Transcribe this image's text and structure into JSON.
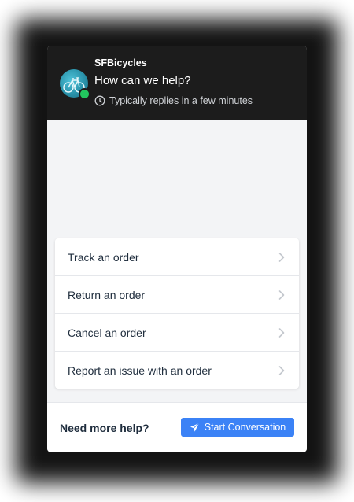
{
  "header": {
    "brand": "SFBicycles",
    "title": "How can we help?",
    "reply_time": "Typically replies in a few minutes",
    "avatar_icon": "bicycle-icon",
    "status": "online"
  },
  "menu": {
    "items": [
      {
        "label": "Track an order",
        "icon": "chevron-right-icon"
      },
      {
        "label": "Return an order",
        "icon": "chevron-right-icon"
      },
      {
        "label": "Cancel an order",
        "icon": "chevron-right-icon"
      },
      {
        "label": "Report an issue with an order",
        "icon": "chevron-right-icon"
      }
    ]
  },
  "footer": {
    "prompt": "Need more help?",
    "button_label": "Start Conversation",
    "button_icon": "paper-plane-icon"
  },
  "colors": {
    "header_bg": "#1c1c1c",
    "accent": "#3b82f6",
    "online": "#22c55e",
    "body_bg": "#f3f4f6",
    "text": "#1f2d3d"
  }
}
